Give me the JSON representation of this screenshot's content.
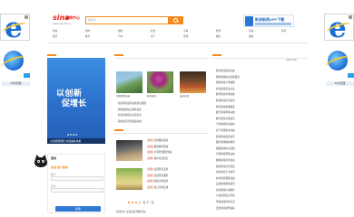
{
  "header": {
    "logo_brand": "sina",
    "logo_text": "新闻中心",
    "logo_url": "news.sina.com.cn",
    "search_scope": "新闻",
    "search_placeholder": "",
    "app_banner_text": "新浪新闻APP下载"
  },
  "nav": {
    "items": [
      "新闻",
      "国内",
      "国际",
      "社会",
      "军事",
      "财经",
      "科技",
      "体育",
      "娱乐",
      "教育",
      "汽车",
      "房产",
      "游戏",
      "图片",
      "视频"
    ]
  },
  "banner": {
    "line1": "以创新",
    "line2": "促增长",
    "caption": "以创新促增长 共创美好未来"
  },
  "login": {
    "title": "登录",
    "welcome_prefix": "欢迎",
    "welcome_user": "用户登录",
    "user_label": "账号",
    "pass_label": "密码",
    "button": "登录"
  },
  "date": "2026.4.20",
  "photos": {
    "captions": [
      "美丽风景如画",
      "鲜花盛开",
      "城市夜景"
    ]
  },
  "mid_list": [
    "新闻资讯最新动态消息报道",
    "国内要闻热点事件追踪",
    "社会新闻民生关注焦点",
    "科技前沿创新发展动态"
  ],
  "news_list_a": [
    {
      "tag": "[组图]",
      "text": "新闻图片报道"
    },
    {
      "tag": "[组图]",
      "text": "精彩瞬间回顾"
    },
    {
      "tag": "[组图]",
      "text": "4月风景摄影作品"
    },
    {
      "tag": "[组图]",
      "text": "城市生活纪实"
    }
  ],
  "news_list_b": [
    {
      "tag": "[组图]",
      "text": "田园风光美景"
    },
    {
      "tag": "[组图]",
      "text": "自然风光摄影"
    },
    {
      "tag": "[组图]",
      "text": "航拍大地美景"
    },
    {
      "tag": "[组图]",
      "text": "春日花海绽放"
    }
  ],
  "right_list": [
    "新闻资讯最新动态",
    "国内新闻热点追踪报道",
    "国际新闻全球视野",
    "社会新闻民生关注",
    "财经新闻市场动态",
    "科技新闻前沿资讯",
    "体育新闻赛事报道",
    "娱乐新闻明星动态",
    "教育新闻考试资讯",
    "汽车新闻新车发布",
    "房产新闻楼市动态",
    "游戏新闻最新资讯",
    "图片新闻精彩瞬间",
    "视频新闻热点追踪",
    "军事新闻国防动态",
    "健康新闻养生知识",
    "旅游新闻出行指南",
    "文化新闻艺术资讯",
    "时尚新闻潮流动态",
    "美食新闻餐饮资讯",
    "读书新闻好书推荐",
    "公益新闻爱心传递",
    "环保新闻绿色生活",
    "法治新闻案件追踪"
  ],
  "pager": "上一页 下一页",
  "footer_text": "新闻中心 意见反馈 网站导航",
  "side_ad": {
    "label": "IE浏览器"
  },
  "colors": {
    "accent": "#f28a1e",
    "brand_red": "#e2231a",
    "link_blue": "#2f78d4"
  }
}
